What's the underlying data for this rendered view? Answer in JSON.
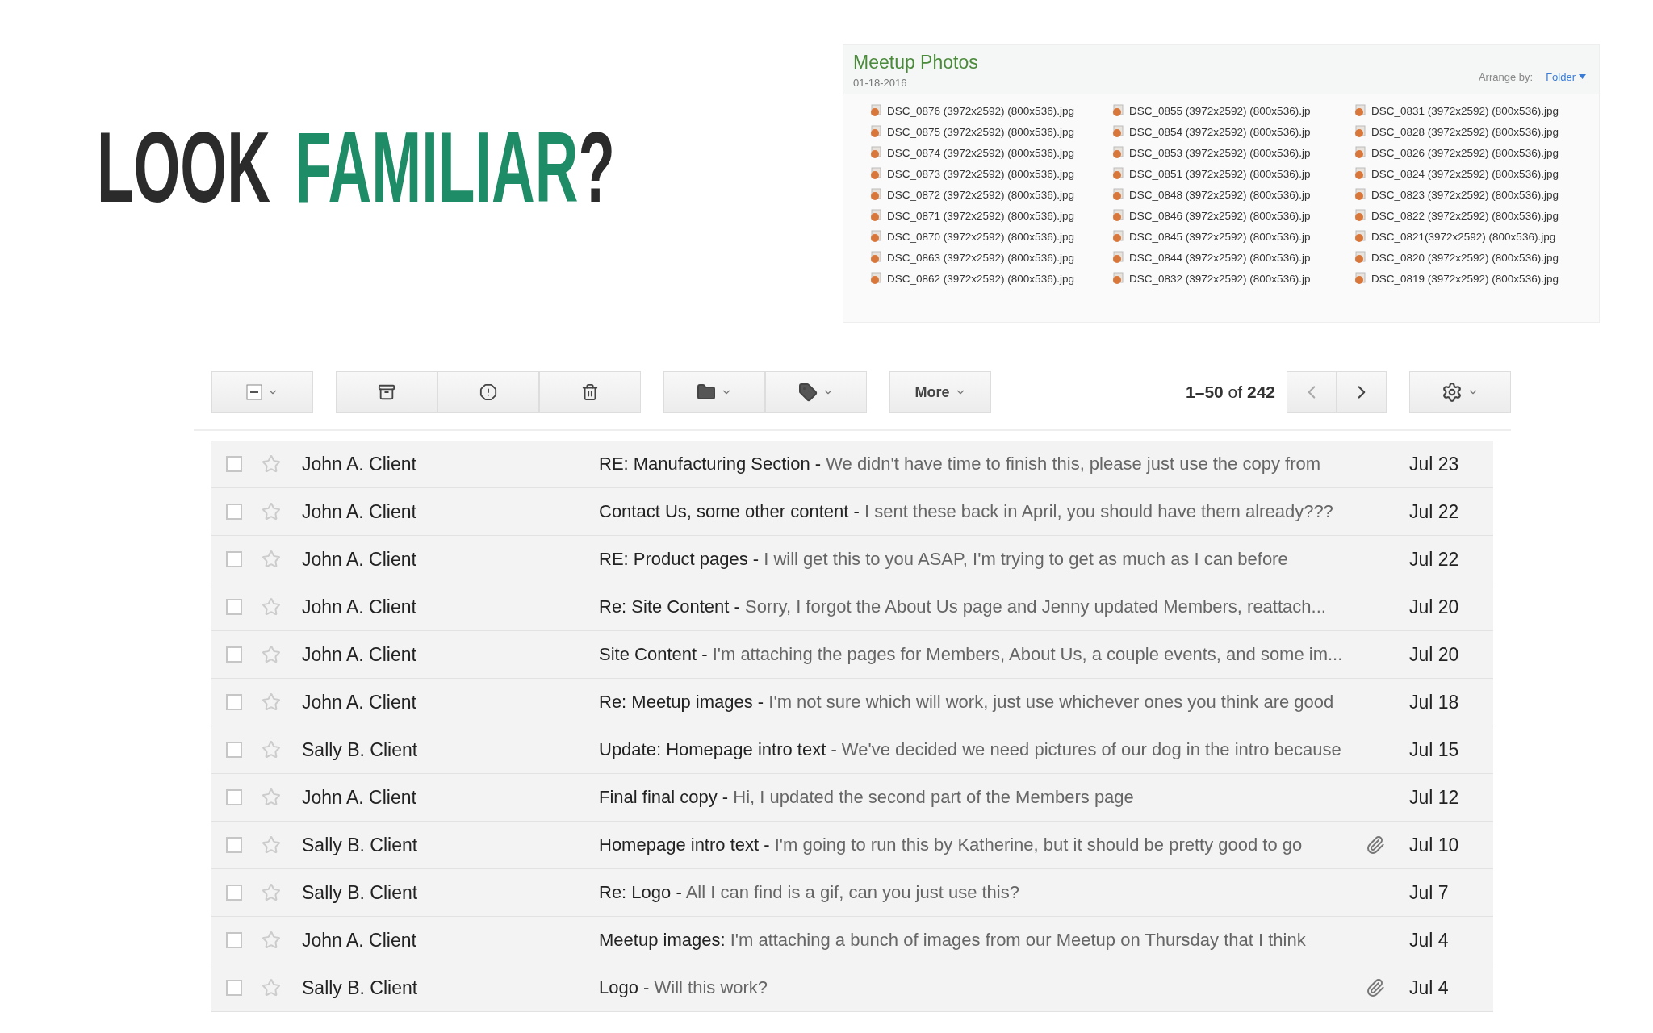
{
  "headline": "LOOK *FAMILIAR*?",
  "photo_panel": {
    "title": "Meetup Photos",
    "date": "01-18-2016",
    "arrange_label": "Arrange by:",
    "arrange_value": "Folder",
    "files": [
      [
        "DSC_0876 (3972x2592) (800x536).jpg",
        "DSC_0875 (3972x2592) (800x536).jpg",
        "DSC_0874 (3972x2592) (800x536).jpg",
        "DSC_0873 (3972x2592) (800x536).jpg",
        "DSC_0872 (3972x2592) (800x536).jpg",
        "DSC_0871 (3972x2592) (800x536).jpg",
        "DSC_0870 (3972x2592) (800x536).jpg",
        "DSC_0863 (3972x2592) (800x536).jpg",
        "DSC_0862 (3972x2592) (800x536).jpg"
      ],
      [
        "DSC_0855 (3972x2592) (800x536).jp",
        "DSC_0854 (3972x2592) (800x536).jp",
        "DSC_0853 (3972x2592) (800x536).jp",
        "DSC_0851 (3972x2592) (800x536).jp",
        "DSC_0848 (3972x2592) (800x536).jp",
        "DSC_0846 (3972x2592) (800x536).jp",
        "DSC_0845 (3972x2592) (800x536).jp",
        "DSC_0844 (3972x2592) (800x536).jp",
        "DSC_0832 (3972x2592) (800x536).jp"
      ],
      [
        "DSC_0831 (3972x2592) (800x536).jpg",
        "DSC_0828 (3972x2592) (800x536).jpg",
        "DSC_0826 (3972x2592) (800x536).jpg",
        "DSC_0824 (3972x2592) (800x536).jpg",
        "DSC_0823 (3972x2592) (800x536).jpg",
        "DSC_0822 (3972x2592) (800x536).jpg",
        "DSC_0821(3972x2592) (800x536).jpg",
        "DSC_0820 (3972x2592) (800x536).jpg",
        "DSC_0819 (3972x2592) (800x536).jpg"
      ]
    ]
  },
  "toolbar": {
    "more": "More",
    "pagination": "**1–50** of **242**"
  },
  "emails": [
    {
      "sender": "John A. Client",
      "text": "**RE: Manufacturing Section -** We didn't have time to finish this, please just use the copy from",
      "date": "Jul 23",
      "checked": false,
      "starred": false,
      "attachment": false
    },
    {
      "sender": "John A. Client",
      "text": "**Contact Us, some other content -** I sent these back in April, you should have them already???",
      "date": "Jul 22",
      "checked": false,
      "starred": false,
      "attachment": false
    },
    {
      "sender": "John A. Client",
      "text": "**RE: Product pages -** I will get this to you ASAP, I'm trying to get as much as I can before",
      "date": "Jul 22",
      "checked": false,
      "starred": false,
      "attachment": false
    },
    {
      "sender": "John A. Client",
      "text": "**Re: Site Content -** Sorry, I forgot the About Us page and Jenny updated Members, reattach...",
      "date": "Jul 20",
      "checked": false,
      "starred": false,
      "attachment": false
    },
    {
      "sender": "John A. Client",
      "text": "**Site Content -** I'm attaching the pages for Members, About Us, a couple events, and some im...",
      "date": "Jul 20",
      "checked": false,
      "starred": false,
      "attachment": false
    },
    {
      "sender": "John A. Client",
      "text": "**Re: Meetup images -** I'm not sure which will work, just use whichever ones you think are good",
      "date": "Jul 18",
      "checked": false,
      "starred": false,
      "attachment": false
    },
    {
      "sender": "Sally B. Client",
      "text": "**Update: Homepage intro text -** We've decided we need pictures of our dog in the intro because",
      "date": "Jul 15",
      "checked": false,
      "starred": false,
      "attachment": false
    },
    {
      "sender": "John A. Client",
      "text": "**Final final copy -** Hi, I updated the second part of the Members page",
      "date": "Jul 12",
      "checked": false,
      "starred": false,
      "attachment": false
    },
    {
      "sender": "Sally B. Client",
      "text": "**Homepage intro text -** I'm going to run this by Katherine, but it should be pretty good to go",
      "date": "Jul 10",
      "checked": false,
      "starred": false,
      "attachment": true
    },
    {
      "sender": "Sally B. Client",
      "text": "**Re: Logo -** All I can find is a gif, can you just use this?",
      "date": "Jul 7",
      "checked": false,
      "starred": false,
      "attachment": false
    },
    {
      "sender": "John A. Client",
      "text": "**Meetup images:** I'm attaching a bunch of images from our Meetup on Thursday that I think",
      "date": "Jul 4",
      "checked": false,
      "starred": false,
      "attachment": false
    },
    {
      "sender": "Sally B. Client",
      "text": "**Logo -** Will this work?",
      "date": "Jul 4",
      "checked": false,
      "starred": false,
      "attachment": true
    }
  ]
}
